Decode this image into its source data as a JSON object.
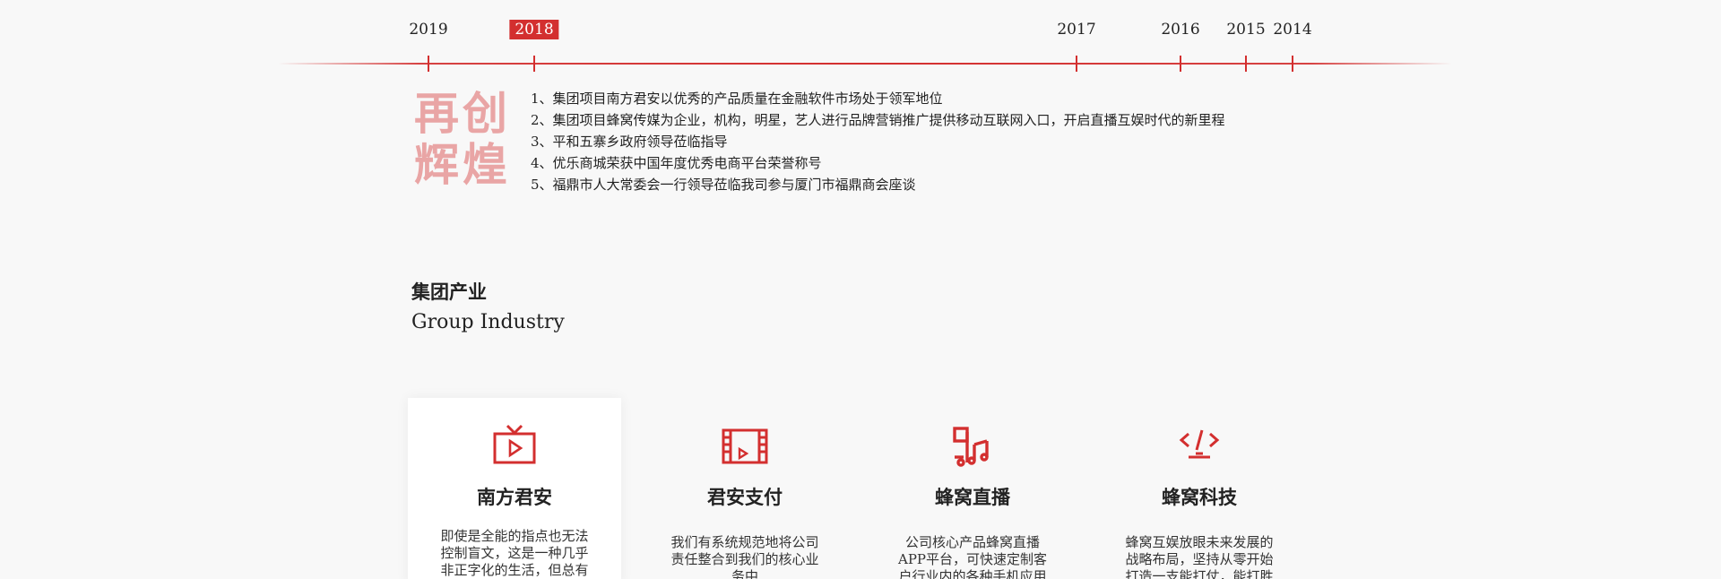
{
  "timeline": {
    "years": [
      "2019",
      "2018",
      "2017",
      "2016",
      "2015",
      "2014"
    ],
    "active": "2018"
  },
  "milestone": {
    "slogan_line1": "再创",
    "slogan_line2": "辉煌",
    "events": [
      "1、集团项目南方君安以优秀的产品质量在金融软件市场处于领军地位",
      "2、集团项目蜂窝传媒为企业，机构，明星，艺人进行品牌营销推广提供移动互联网入口，开启直播互娱时代的新里程",
      "3、平和五寨乡政府领导莅临指导",
      "4、优乐商城荣获中国年度优秀电商平台荣誉称号",
      "5、福鼎市人大常委会一行领导莅临我司参与厦门市福鼎商会座谈"
    ]
  },
  "section": {
    "title_cn": "集团产业",
    "title_en": "Group Industry"
  },
  "cards": [
    {
      "icon": "tv-icon",
      "title": "南方君安",
      "desc": "即使是全能的指点也无法控制盲文，这是一种几乎非正字化的生活，但总有"
    },
    {
      "icon": "film-icon",
      "title": "君安支付",
      "desc": "我们有系统规范地将公司责任整合到我们的核心业务中"
    },
    {
      "icon": "music-icon",
      "title": "蜂窝直播",
      "desc": "公司核心产品蜂窝直播APP平台，可快速定制客户行业内的各种手机应用"
    },
    {
      "icon": "code-icon",
      "title": "蜂窝科技",
      "desc": "蜂窝互娱放眼未来发展的战略布局，坚持从零开始打造一支能打仗，能打胜"
    }
  ],
  "colors": {
    "accent": "#d32f2f",
    "slogan": "#e9a5a5",
    "background": "#f8f8f8"
  }
}
